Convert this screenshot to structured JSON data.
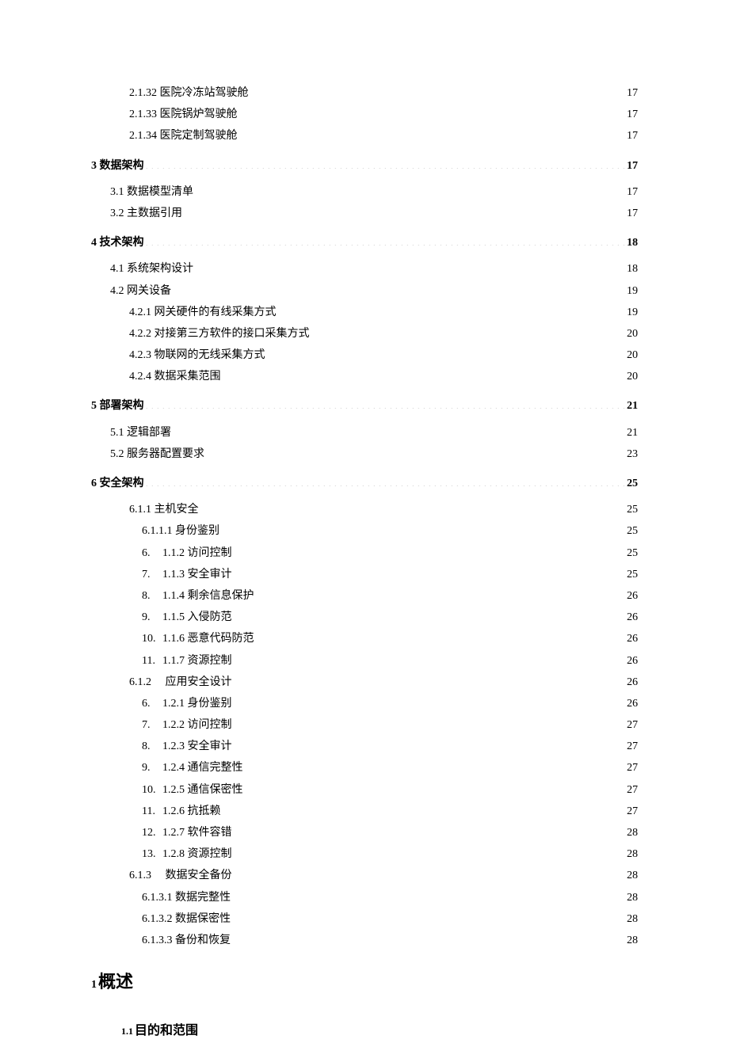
{
  "toc": [
    {
      "indent": 2,
      "bold": false,
      "label": "2.1.32 医院冷冻站驾驶舱",
      "page": "17"
    },
    {
      "indent": 2,
      "bold": false,
      "label": "2.1.33 医院锅炉驾驶舱",
      "page": "17"
    },
    {
      "indent": 2,
      "bold": false,
      "label": "2.1.34 医院定制驾驶舱",
      "page": "17"
    },
    {
      "indent": 0,
      "bold": true,
      "label": "3 数据架构",
      "page": "17",
      "gap": true
    },
    {
      "indent": 1,
      "bold": false,
      "label": "3.1 数据模型清单",
      "page": "17",
      "gap_before": true
    },
    {
      "indent": 1,
      "bold": false,
      "label": "3.2 主数据引用",
      "page": "17"
    },
    {
      "indent": 0,
      "bold": true,
      "label": "4 技术架构",
      "page": "18",
      "gap": true
    },
    {
      "indent": 1,
      "bold": false,
      "label": "4.1 系统架构设计",
      "page": "18",
      "gap_before": true
    },
    {
      "indent": 1,
      "bold": false,
      "label": "4.2 网关设备",
      "page": "19"
    },
    {
      "indent": 2,
      "bold": false,
      "label": "4.2.1 网关硬件的有线采集方式",
      "page": "19"
    },
    {
      "indent": 2,
      "bold": false,
      "label": "4.2.2 对接第三方软件的接口采集方式",
      "page": "20"
    },
    {
      "indent": 2,
      "bold": false,
      "label": "4.2.3 物联网的无线采集方式",
      "page": "20"
    },
    {
      "indent": 2,
      "bold": false,
      "label": "4.2.4 数据采集范围",
      "page": "20"
    },
    {
      "indent": 0,
      "bold": true,
      "label": "5 部署架构",
      "page": "21",
      "gap": true
    },
    {
      "indent": 1,
      "bold": false,
      "label": "5.1 逻辑部署",
      "page": "21",
      "gap_before": true
    },
    {
      "indent": 1,
      "bold": false,
      "label": "5.2 服务器配置要求",
      "page": "23"
    },
    {
      "indent": 0,
      "bold": true,
      "label": "6 安全架构",
      "page": "25",
      "gap": true
    },
    {
      "indent": 2,
      "bold": false,
      "label": "6.1.1 主机安全",
      "page": "25",
      "gap_before": true
    },
    {
      "indent": 3,
      "bold": false,
      "label": "6.1.1.1 身份鉴别",
      "page": "25"
    },
    {
      "indent": 3,
      "bold": false,
      "num": "6.",
      "label": "1.1.2 访问控制",
      "page": "25"
    },
    {
      "indent": 3,
      "bold": false,
      "num": "7.",
      "label": "1.1.3 安全审计",
      "page": "25"
    },
    {
      "indent": 3,
      "bold": false,
      "num": "8.",
      "label": "1.1.4 剩余信息保护",
      "page": "26"
    },
    {
      "indent": 3,
      "bold": false,
      "num": "9.",
      "label": "1.1.5 入侵防范",
      "page": "26"
    },
    {
      "indent": 3,
      "bold": false,
      "num": "10.",
      "label": "1.1.6 恶意代码防范",
      "page": "26"
    },
    {
      "indent": 3,
      "bold": false,
      "num": "11.",
      "label": "1.1.7 资源控制",
      "page": "26"
    },
    {
      "indent": 2,
      "bold": false,
      "label": "6.1.2　 应用安全设计",
      "page": "26"
    },
    {
      "indent": 3,
      "bold": false,
      "num": "6.",
      "label": "1.2.1 身份鉴别",
      "page": "26"
    },
    {
      "indent": 3,
      "bold": false,
      "num": "7.",
      "label": "1.2.2 访问控制",
      "page": "27"
    },
    {
      "indent": 3,
      "bold": false,
      "num": "8.",
      "label": "1.2.3 安全审计",
      "page": "27"
    },
    {
      "indent": 3,
      "bold": false,
      "num": "9.",
      "label": "1.2.4 通信完整性",
      "page": "27"
    },
    {
      "indent": 3,
      "bold": false,
      "num": "10.",
      "label": "1.2.5 通信保密性",
      "page": "27"
    },
    {
      "indent": 3,
      "bold": false,
      "num": "11.",
      "label": "1.2.6 抗抵赖",
      "page": "27"
    },
    {
      "indent": 3,
      "bold": false,
      "num": "12.",
      "label": "1.2.7 软件容错",
      "page": "28"
    },
    {
      "indent": 3,
      "bold": false,
      "num": "13.",
      "label": "1.2.8 资源控制",
      "page": "28"
    },
    {
      "indent": 2,
      "bold": false,
      "label": "6.1.3　 数据安全备份",
      "page": "28"
    },
    {
      "indent": 3,
      "bold": false,
      "label": "6.1.3.1 数据完整性",
      "page": "28"
    },
    {
      "indent": 3,
      "bold": false,
      "label": "6.1.3.2 数据保密性",
      "page": "28"
    },
    {
      "indent": 3,
      "bold": false,
      "label": "6.1.3.3 备份和恢复",
      "page": "28"
    }
  ],
  "headings": {
    "h1_num": "1",
    "h1_text": "概述",
    "h2_num": "1.1",
    "h2_text": "目的和范围"
  }
}
